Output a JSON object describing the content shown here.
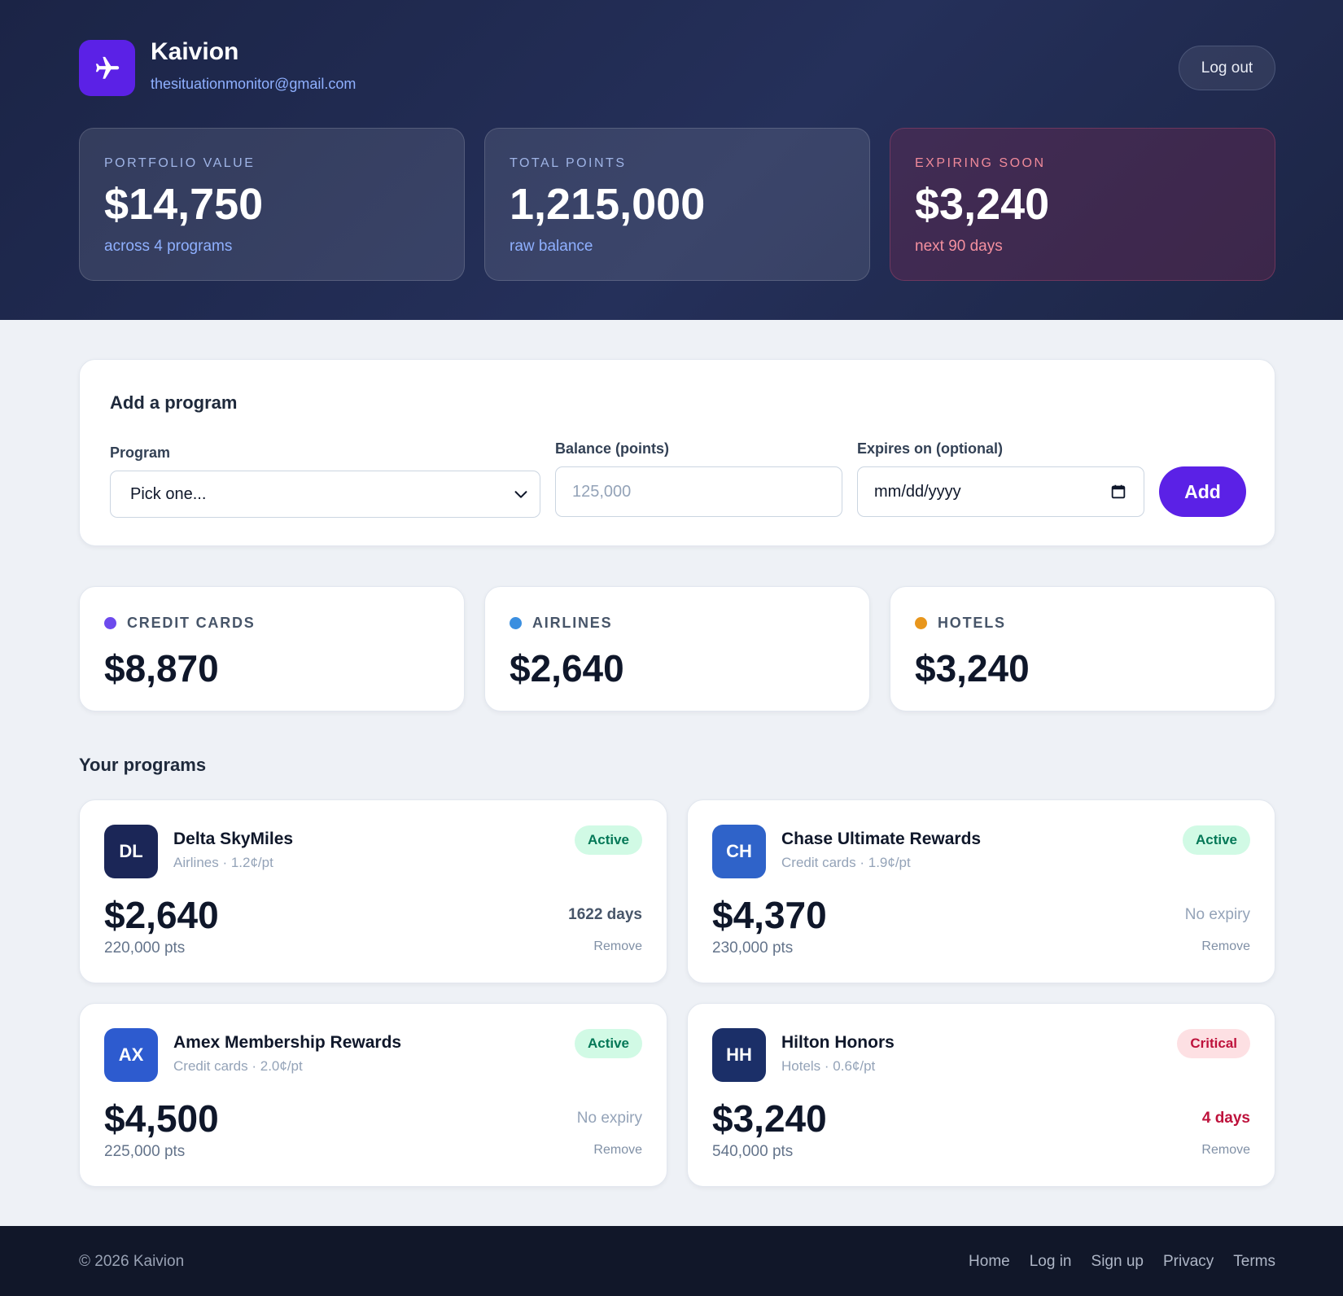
{
  "brand": {
    "name": "Kaivion",
    "email": "thesituationmonitor@gmail.com",
    "logo_icon": "airplane-icon",
    "logo_color": "#5b21e6"
  },
  "header": {
    "logout_label": "Log out"
  },
  "stats": [
    {
      "label": "PORTFOLIO VALUE",
      "value": "$14,750",
      "sub": "across 4 programs"
    },
    {
      "label": "TOTAL POINTS",
      "value": "1,215,000",
      "sub": "raw balance"
    },
    {
      "label": "EXPIRING SOON",
      "value": "$3,240",
      "sub": "next 90 days"
    }
  ],
  "add_program": {
    "title": "Add a program",
    "program_label": "Program",
    "program_value": "Pick one...",
    "balance_label": "Balance (points)",
    "balance_placeholder": "125,000",
    "expires_label": "Expires on (optional)",
    "expires_placeholder": "mm/dd/yyyy",
    "add_label": "Add"
  },
  "categories": [
    {
      "label": "CREDIT CARDS",
      "value": "$8,870",
      "color": "#6d4aed"
    },
    {
      "label": "AIRLINES",
      "value": "$2,640",
      "color": "#3b8fe0"
    },
    {
      "label": "HOTELS",
      "value": "$3,240",
      "color": "#e8961c"
    }
  ],
  "programs_title": "Your programs",
  "programs": [
    {
      "initials": "DL",
      "name": "Delta SkyMiles",
      "meta": "Airlines · 1.2¢/pt",
      "status": "Active",
      "value": "$2,640",
      "points": "220,000 pts",
      "expiry": "1622 days",
      "remove": "Remove",
      "avatar_color": "#1b2657"
    },
    {
      "initials": "CH",
      "name": "Chase Ultimate Rewards",
      "meta": "Credit cards · 1.9¢/pt",
      "status": "Active",
      "value": "$4,370",
      "points": "230,000 pts",
      "expiry": "No expiry",
      "remove": "Remove",
      "avatar_color": "#2f63c9"
    },
    {
      "initials": "AX",
      "name": "Amex Membership Rewards",
      "meta": "Credit cards · 2.0¢/pt",
      "status": "Active",
      "value": "$4,500",
      "points": "225,000 pts",
      "expiry": "No expiry",
      "remove": "Remove",
      "avatar_color": "#2d5bcf"
    },
    {
      "initials": "HH",
      "name": "Hilton Honors",
      "meta": "Hotels · 0.6¢/pt",
      "status": "Critical",
      "value": "$3,240",
      "points": "540,000 pts",
      "expiry": "4 days",
      "remove": "Remove",
      "avatar_color": "#1b2f68"
    }
  ],
  "footer": {
    "copyright": "© 2026 Kaivion",
    "links": [
      "Home",
      "Log in",
      "Sign up",
      "Privacy",
      "Terms"
    ]
  }
}
